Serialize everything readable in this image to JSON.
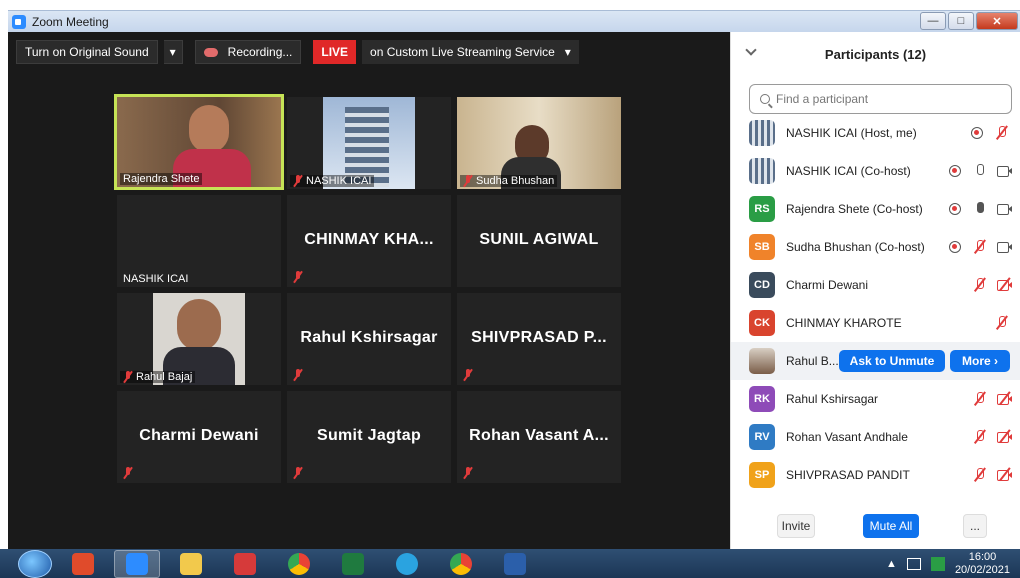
{
  "window": {
    "title": "Zoom Meeting"
  },
  "toolbar": {
    "original_sound": "Turn on Original Sound",
    "recording": "Recording...",
    "live": "LIVE",
    "stream_service": "on Custom Live Streaming Service"
  },
  "tiles": [
    {
      "name": "Rajendra Shete",
      "type": "video",
      "active": true
    },
    {
      "name": "NASHIK ICAI",
      "type": "video"
    },
    {
      "name": "Sudha Bhushan",
      "type": "video"
    },
    {
      "name": "NASHIK ICAI",
      "type": "name-only"
    },
    {
      "label": "CHINMAY  KHA...",
      "type": "text"
    },
    {
      "label": "SUNIL  AGIWAL",
      "type": "text"
    },
    {
      "name": "Rahul Bajaj",
      "type": "video"
    },
    {
      "label": "Rahul Kshirsagar",
      "type": "text"
    },
    {
      "label": "SHIVPRASAD  P...",
      "type": "text"
    },
    {
      "label": "Charmi Dewani",
      "type": "text"
    },
    {
      "label": "Sumit Jagtap",
      "type": "text"
    },
    {
      "label": "Rohan Vasant A...",
      "type": "text"
    }
  ],
  "participants_panel": {
    "title": "Participants (12)",
    "search_placeholder": "Find a participant",
    "items": [
      {
        "name": "NASHIK ICAI (Host, me)",
        "avatar": "img",
        "color": "#7a8a7a"
      },
      {
        "name": "NASHIK ICAI (Co-host)",
        "avatar": "img",
        "color": "#7a8a7a"
      },
      {
        "name": "Rajendra Shete (Co-host)",
        "initials": "RS",
        "color": "#2a9d45"
      },
      {
        "name": "Sudha Bhushan (Co-host)",
        "initials": "SB",
        "color": "#f0832a"
      },
      {
        "name": "Charmi Dewani",
        "initials": "CD",
        "color": "#3a4b5c"
      },
      {
        "name": "CHINMAY KHAROTE",
        "initials": "CK",
        "color": "#d9442e"
      },
      {
        "name": "Rahul B...",
        "avatar": "img",
        "color": "#6b5a4a"
      },
      {
        "name": "Rahul Kshirsagar",
        "initials": "RK",
        "color": "#8e4bb8"
      },
      {
        "name": "Rohan Vasant Andhale",
        "initials": "RV",
        "color": "#2f7bc4"
      },
      {
        "name": "SHIVPRASAD PANDIT",
        "initials": "SP",
        "color": "#f0a21a"
      }
    ],
    "ask_to_unmute": "Ask to Unmute",
    "more": "More ›",
    "invite": "Invite",
    "mute_all": "Mute All",
    "ellipsis": "..."
  },
  "taskbar": {
    "time": "16:00",
    "date": "20/02/2021"
  }
}
